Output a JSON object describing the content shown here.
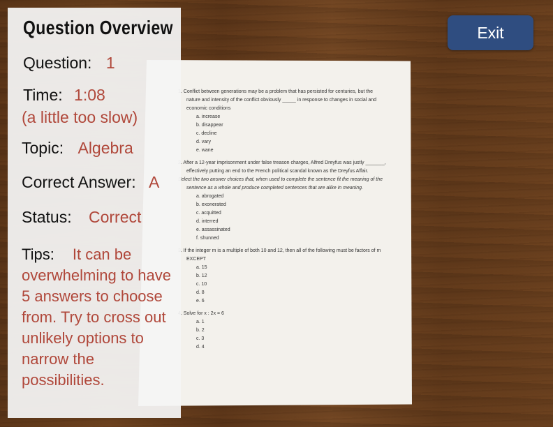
{
  "overview": {
    "title": "Question Overview",
    "question_label": "Question:",
    "question_value": "1",
    "time_label": "Time:",
    "time_value": "1:08",
    "time_note": "(a little too slow)",
    "topic_label": "Topic:",
    "topic_value": "Algebra",
    "answer_label": "Correct Answer:",
    "answer_value": "A",
    "status_label": "Status:",
    "status_value": "Correct",
    "tips_label": "Tips:",
    "tips_value": "It can be overwhelming to have 5 answers to choose from. Try to cross out unlikely options to narrow the possibilities."
  },
  "exit_button": {
    "label": "Exit"
  },
  "colors": {
    "value_text": "#b0473a",
    "exit_button": "#2f4d80",
    "panel": "#f4f4f4"
  },
  "paper": {
    "questions": [
      {
        "stem": "1. Conflict between generations may be a problem that has persisted for centuries, but the nature and intensity of the conflict obviously _____ in response to changes in social and economic conditions",
        "instruction": "",
        "choices": [
          "a. increase",
          "b. disappear",
          "c. decline",
          "d. vary",
          "e. wane"
        ]
      },
      {
        "stem": "2. After a 12-year imprisonment under false treason charges, Alfred Dreyfus was justly _______, effectively putting an end to the French political scandal known as the Dreyfus Affair.",
        "instruction": "Select the two answer choices that, when used to complete the sentence fit the meaning of the sentence as a whole and produce completed sentences that are alike in meaning.",
        "choices": [
          "a. abrogated",
          "b. exonerated",
          "c. acquitted",
          "d. interred",
          "e. assassinated",
          "f. shunned"
        ]
      },
      {
        "stem": "3. If the integer m is a multiple of both 10 and 12, then all of the following must be factors of m EXCEPT",
        "instruction": "",
        "choices": [
          "a. 15",
          "b. 12",
          "c. 10",
          "d. 8",
          "e. 6"
        ]
      },
      {
        "stem": "4. Solve for x : 2x = 6",
        "instruction": "",
        "choices": [
          "a. 1",
          "b. 2",
          "c. 3",
          "d. 4"
        ]
      }
    ]
  }
}
